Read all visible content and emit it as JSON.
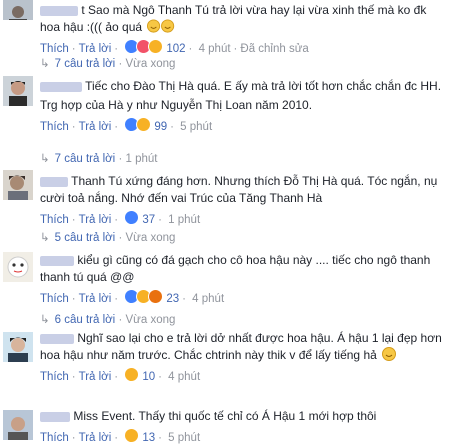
{
  "comments": [
    {
      "name": "",
      "text": "t Sao mà Ngô Thanh Tú trả lời vừa hay lại vừa xinh thế mà ko đk hoa hậu :((( ảo quá",
      "like_label": "Thích",
      "reply_label": "Trả lời",
      "reactions_count": "102",
      "time": "4 phút",
      "edited": "Đã chỉnh sửa",
      "replies_label": "7 câu trả lời",
      "replies_time": "Vừa xong"
    },
    {
      "name": "",
      "text": "Tiếc cho Đào Thị Hà quá. E ấy mà trả lời tốt hơn chắc chắn đc HH.",
      "text2": "Trg hợp của Hà y như Nguyễn Thị Loan năm 2010.",
      "like_label": "Thích",
      "reply_label": "Trả lời",
      "reactions_count": "99",
      "time": "5 phút",
      "replies_label": "7 câu trả lời",
      "replies_time": "1 phút"
    },
    {
      "name": "Thanh Tú xứng đáng hơn. Nhưng thích Đỗ Thị Hà quá. Tóc ngắn, nụ cười toả nắng. Nhớ đến vai Trúc của Tăng Thanh Hà",
      "like_label": "Thích",
      "reply_label": "Trả lời",
      "reactions_count": "37",
      "time": "1 phút",
      "replies_label": "5 câu trả lời",
      "replies_time": "Vừa xong"
    },
    {
      "text": "kiểu gì cũng có đá gạch cho cô hoa hậu này .... tiếc cho ngô thanh thanh tú quá @@",
      "like_label": "Thích",
      "reply_label": "Trả lời",
      "reactions_count": "23",
      "time": "4 phút",
      "replies_label": "6 câu trả lời",
      "replies_time": "Vừa xong"
    },
    {
      "text": "Nghĩ sao lại cho e trả lời dở nhất được hoa hậu. Á hậu 1 lại đẹp hơn hoa hậu như năm trước. Chắc chtrinh này thik v để lấy tiếng hả",
      "like_label": "Thích",
      "reply_label": "Trả lời",
      "reactions_count": "10",
      "time": "4 phút"
    },
    {
      "text": "Miss Event. Thấy thi quốc tế chỉ có Á Hậu 1 mới hợp thôi",
      "like_label": "Thích",
      "reply_label": "Trả lời",
      "reactions_count": "13",
      "time": "5 phút"
    }
  ],
  "colors": {
    "link": "#4267b2",
    "name": "#365899",
    "meta": "#90949c"
  }
}
